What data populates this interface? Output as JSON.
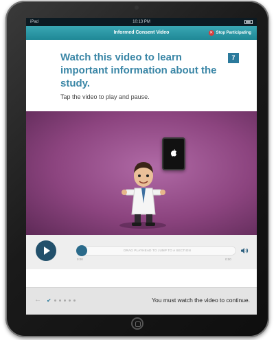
{
  "statusbar": {
    "carrier": "iPad",
    "time": "10:13 PM"
  },
  "navbar": {
    "title": "Informed Consent Video",
    "stop_label": "Stop Participating",
    "stop_icon": "x-icon"
  },
  "content": {
    "heading": "Watch this video to learn important information about the study.",
    "step_number": "7",
    "instruction": "Tap the video to play and pause."
  },
  "player": {
    "scrub_hint": "DRAG PLAYHEAD TO JUMP TO A SECTION",
    "time_start": "0:00",
    "time_end": "0:00",
    "progress": 0
  },
  "footer": {
    "message": "You must watch the video to continue.",
    "progress_dots": 5,
    "completed_steps": 1
  },
  "colors": {
    "accent": "#2b7a9c",
    "nav": "#1f8896",
    "video_bg": "#8c447f",
    "stop": "#d93b3b"
  }
}
